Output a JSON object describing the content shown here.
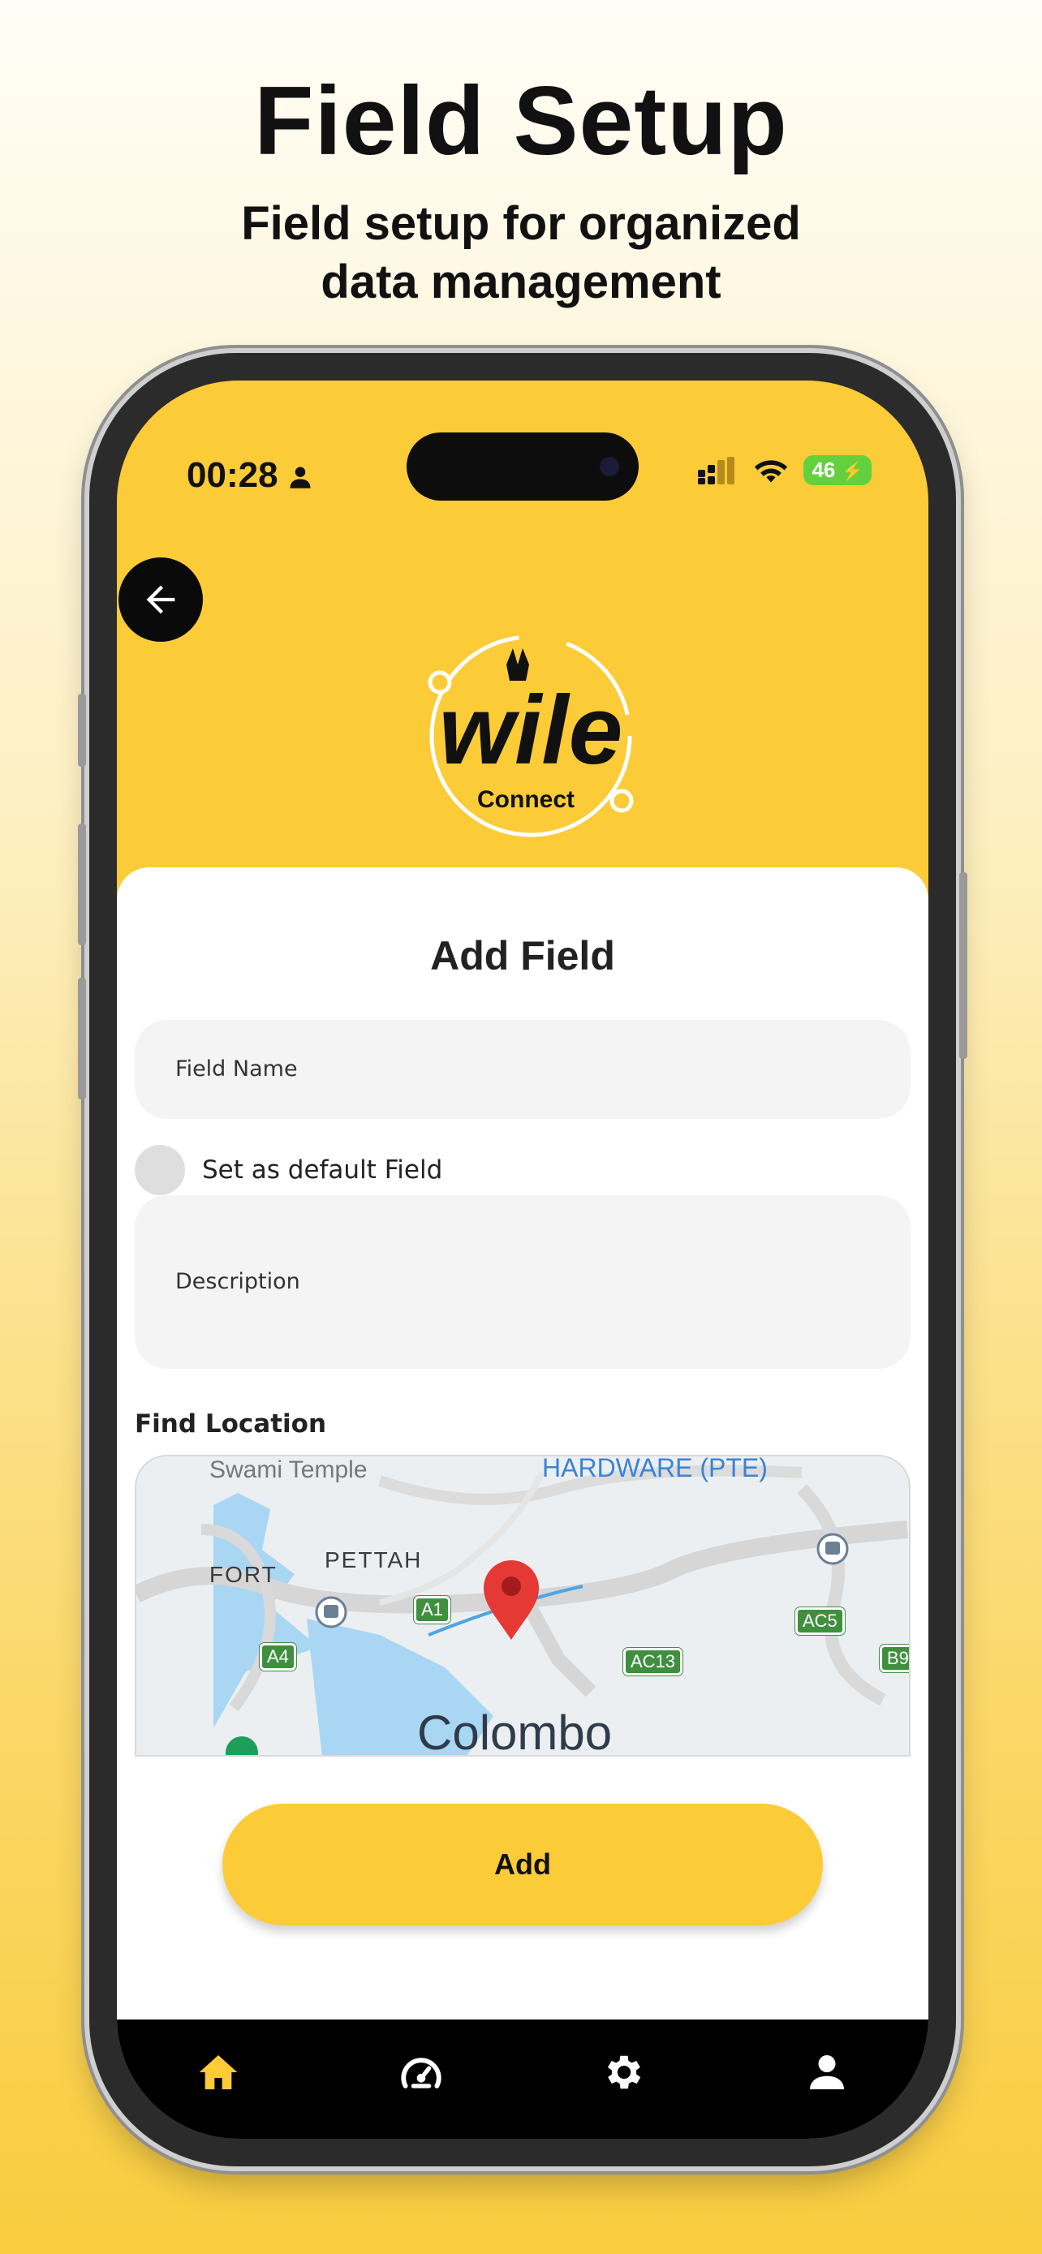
{
  "promo": {
    "headline": "Field Setup",
    "subline_1": "Field setup for organized",
    "subline_2": "data management"
  },
  "status_bar": {
    "time": "00:28",
    "battery": "46"
  },
  "logo": {
    "text": "wile",
    "subtext": "Connect"
  },
  "form": {
    "title": "Add Field",
    "field_name_placeholder": "Field Name",
    "default_label": "Set as default Field",
    "description_placeholder": "Description",
    "find_location_label": "Find Location",
    "submit_label": "Add"
  },
  "map": {
    "labels": [
      "FORT",
      "PETTAH",
      "Colombo",
      "HARDWARE (PTE)",
      "Swami Temple"
    ],
    "badges": [
      "A1",
      "A4",
      "AC13",
      "AC5",
      "B9"
    ]
  },
  "nav": {
    "items": [
      "home-icon",
      "dashboard-icon",
      "gear-icon",
      "profile-icon"
    ],
    "active": "home-icon"
  },
  "colors": {
    "brand_yellow": "#fccb38",
    "nav_bg": "#000000",
    "active_icon": "#fccb38",
    "inactive_icon": "#ffffff"
  }
}
